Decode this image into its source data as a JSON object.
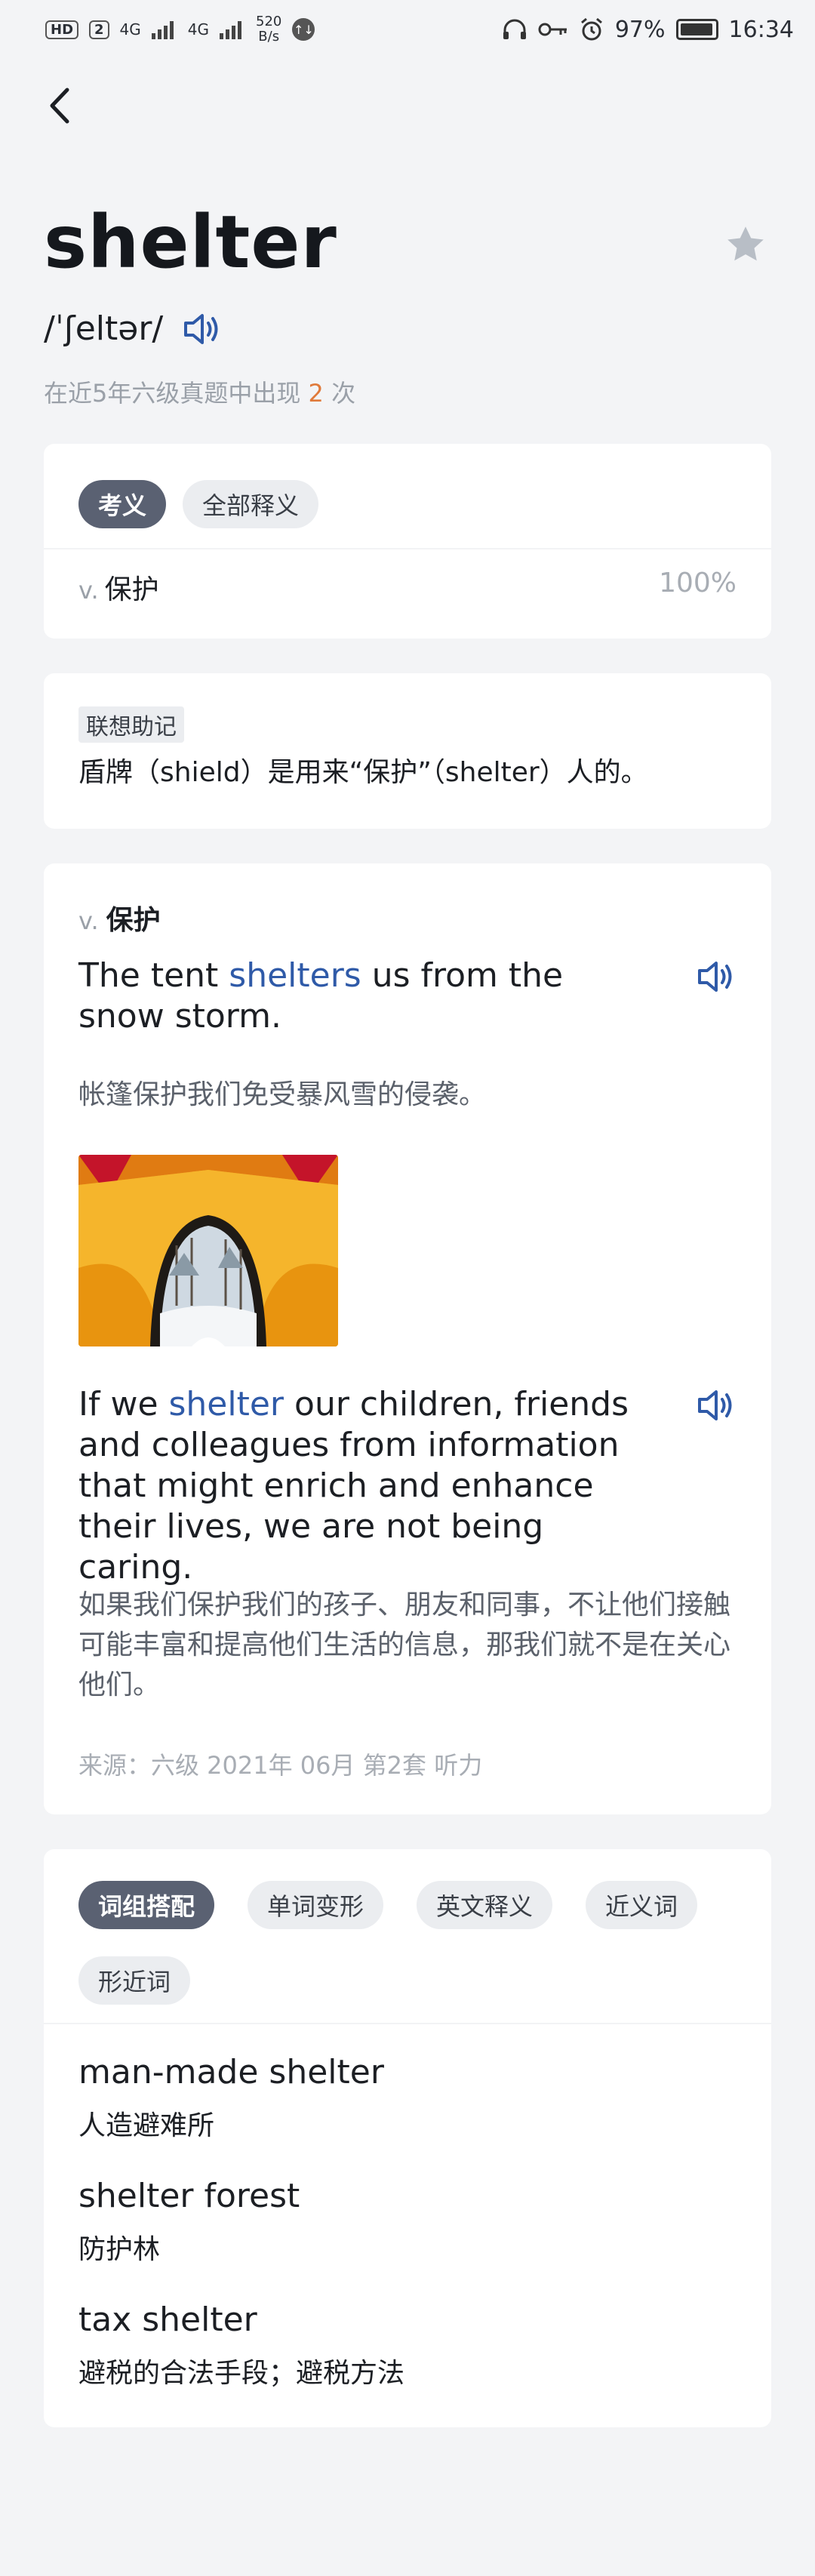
{
  "status_bar": {
    "hd": "HD",
    "sim": "2",
    "net1": "4G",
    "net2": "4G",
    "speed_value": "520",
    "speed_unit": "B/s",
    "battery": "97%",
    "time": "16:34"
  },
  "header": {
    "word": "shelter",
    "phonetic": "/ˈʃeltər/",
    "frequency_prefix": "在近5年六级真题中出现",
    "frequency_count": "2",
    "frequency_suffix": "次"
  },
  "meaning_card": {
    "tabs": [
      "考义",
      "全部释义"
    ],
    "pos": "v.",
    "meaning": "保护",
    "percent": "100%"
  },
  "mnemonic_card": {
    "tag": "联想助记",
    "text": "盾牌（shield）是用来“保护”（shelter）人的。"
  },
  "example_card": {
    "pos": "v.",
    "meaning": "保护",
    "example1": {
      "before": "The tent ",
      "highlight": "shelters",
      "after": " us from the snow storm.",
      "translation": "帐篷保护我们免受暴风雪的侵袭。"
    },
    "example2": {
      "before": "If we ",
      "highlight": "shelter",
      "after": " our children, friends and colleagues from information that might enrich and enhance their lives, we are not being caring.",
      "translation": "如果我们保护我们的孩子、朋友和同事，不让他们接触可能丰富和提高他们生活的信息，那我们就不是在关心他们。"
    },
    "source": "来源：六级 2021年 06月 第2套 听力"
  },
  "phrases_card": {
    "tabs": [
      "词组搭配",
      "单词变形",
      "英文释义",
      "近义词",
      "形近词"
    ],
    "phrases": [
      {
        "en": "man-made shelter",
        "zh": "人造避难所"
      },
      {
        "en": "shelter forest",
        "zh": "防护林"
      },
      {
        "en": "tax shelter",
        "zh": "避税的合法手段；避税方法"
      }
    ]
  },
  "colors": {
    "background": "#f3f4f6",
    "accent_blue": "#2f5aa8",
    "count_orange": "#e07a3a",
    "active_chip": "#5a6172"
  },
  "icons": [
    "back-arrow-icon",
    "star-icon",
    "speaker-icon",
    "alarm-icon",
    "key-icon",
    "headphones-icon"
  ]
}
